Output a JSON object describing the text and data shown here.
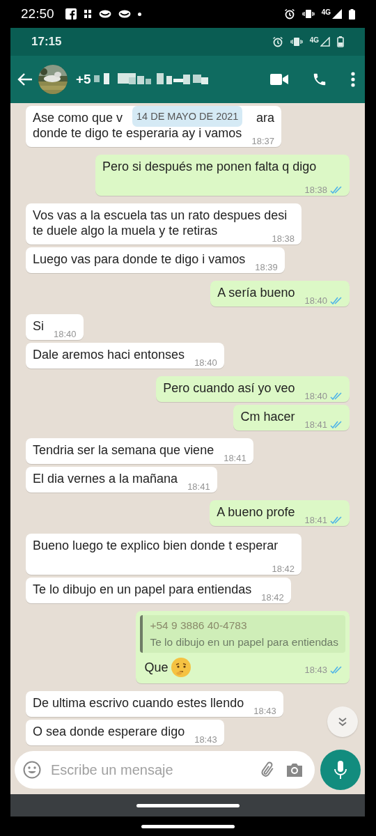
{
  "outer_status_bar": {
    "time": "22:50",
    "network": "4G"
  },
  "status_bar": {
    "time": "17:15",
    "network": "4G"
  },
  "header": {
    "contact": "+5"
  },
  "date_chip": "14 DE MAYO DE 2021",
  "messages": [
    {
      "kind": "covered",
      "parts": [
        "Ase como que v",
        "ara",
        "donde te digo te esperaria ay i vamos"
      ],
      "time": "18:37"
    },
    {
      "kind": "out",
      "text": "Pero si después me ponen falta q digo",
      "time": "18:38",
      "read": true
    },
    {
      "kind": "in",
      "text": "Vos vas a la escuela tas un rato despues desi te duele algo la muela y te retiras",
      "time": "18:38"
    },
    {
      "kind": "in",
      "text": "Luego vas para donde te digo i vamos",
      "time": "18:39"
    },
    {
      "kind": "out",
      "text": "A sería bueno",
      "time": "18:40",
      "read": true
    },
    {
      "kind": "in",
      "text": "Si",
      "time": "18:40"
    },
    {
      "kind": "in",
      "text": "Dale aremos haci entonses",
      "time": "18:40"
    },
    {
      "kind": "out",
      "text": "Pero cuando así yo veo",
      "time": "18:40",
      "read": true
    },
    {
      "kind": "out",
      "text": "Cm hacer",
      "time": "18:41",
      "read": true
    },
    {
      "kind": "in",
      "text": "Tendria ser la semana que viene",
      "time": "18:41"
    },
    {
      "kind": "in",
      "text": "El dia vernes a la mañana",
      "time": "18:41"
    },
    {
      "kind": "out",
      "text": "A bueno profe",
      "time": "18:41",
      "read": true
    },
    {
      "kind": "in",
      "text": "Bueno luego te explico bien donde t esperar",
      "time": "18:42"
    },
    {
      "kind": "in",
      "text": "Te lo dibujo en un papel para entiendas",
      "time": "18:42"
    },
    {
      "kind": "quote",
      "quote_author": "+54 9 3886 40-4783",
      "quote_text": "Te lo dibujo en un papel para entiendas",
      "text": "Que",
      "time": "18:43",
      "read": true
    },
    {
      "kind": "in",
      "text": "De ultima escrivo cuando estes llendo",
      "time": "18:43"
    },
    {
      "kind": "in",
      "text": "O sea donde esperare digo",
      "time": "18:43"
    }
  ],
  "composer": {
    "placeholder": "Escribe un mensaje"
  }
}
